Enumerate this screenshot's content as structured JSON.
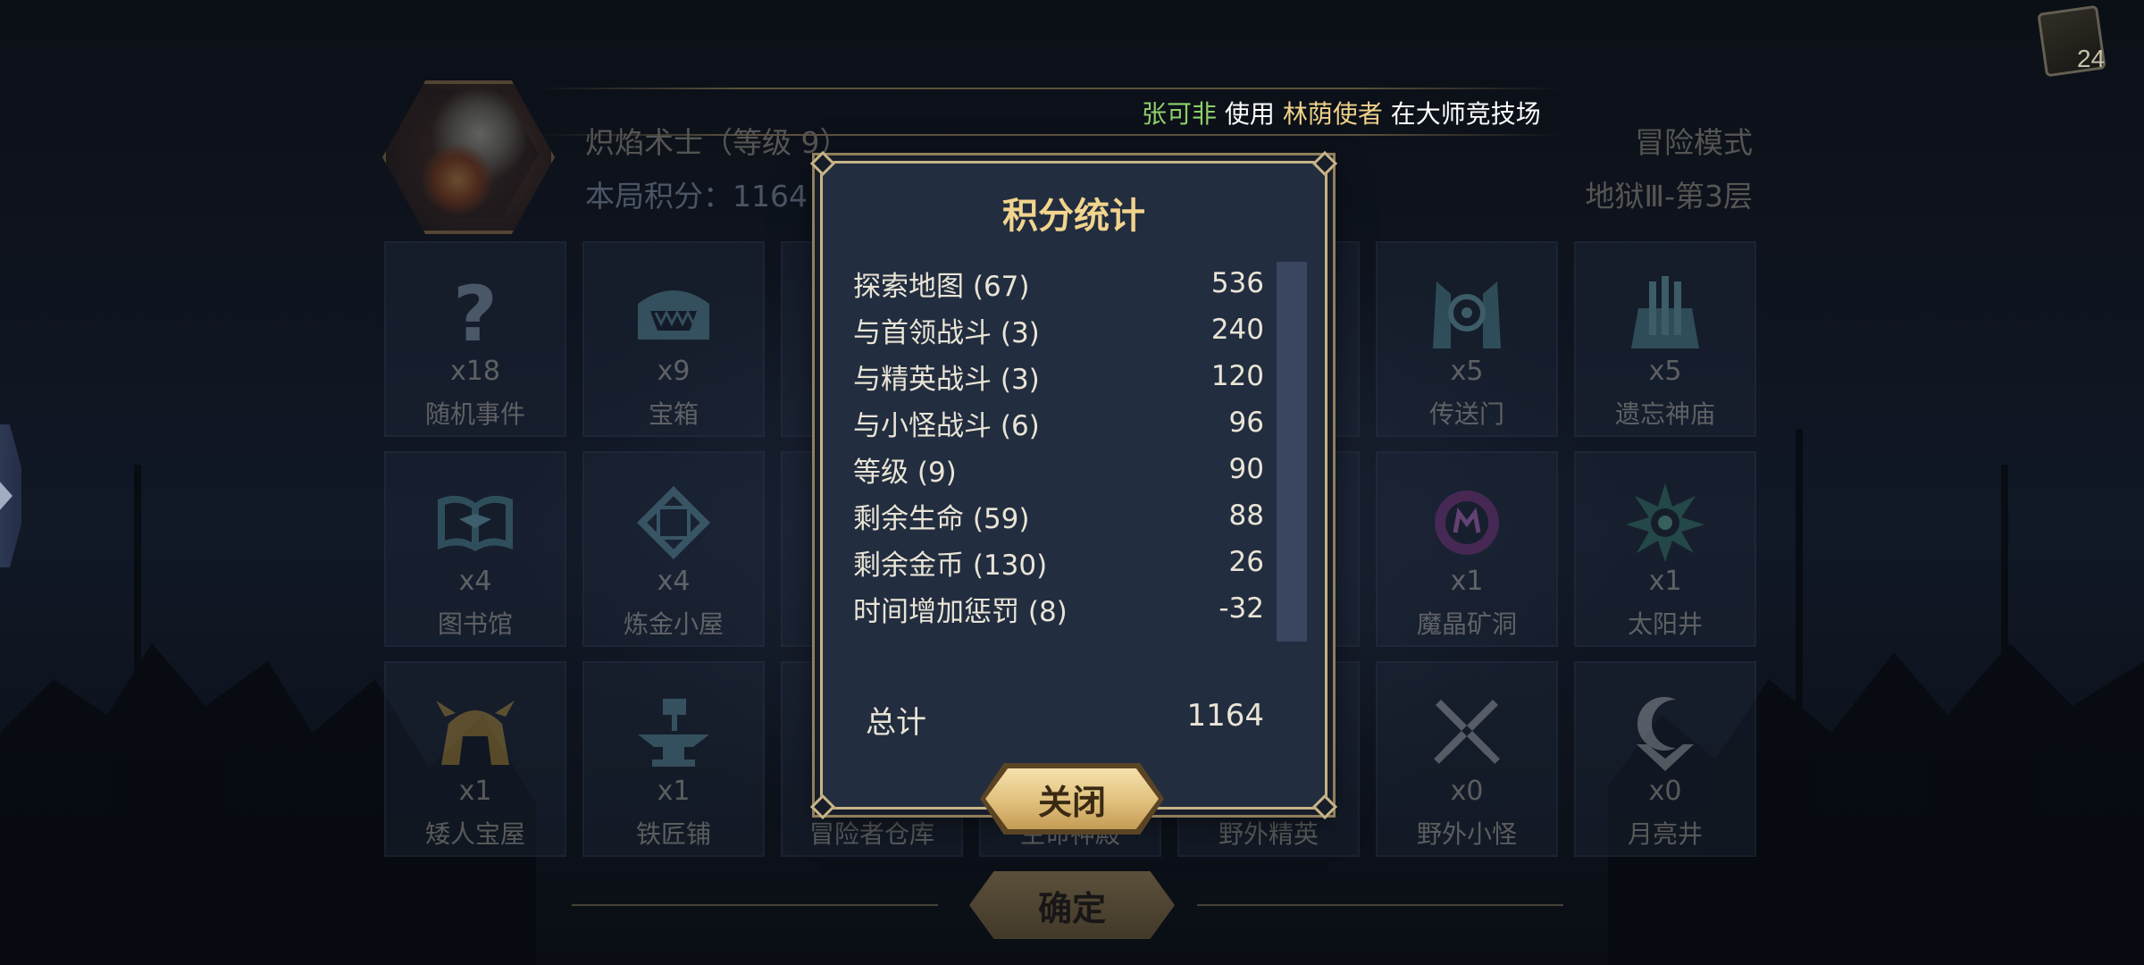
{
  "deck": {
    "count": "24"
  },
  "header": {
    "hero_name": "炽焰术士（等级 9）",
    "score_label": "本局积分：1164",
    "mode": "冒险模式",
    "floor": "地狱Ⅲ-第3层"
  },
  "notice": {
    "player": "张可非",
    "verb": "使用",
    "hero": "林荫使者",
    "place": "在大师竞技场"
  },
  "tiles": [
    {
      "icon": "question-icon",
      "count": "x18",
      "name": "随机事件"
    },
    {
      "icon": "treasure-chest-icon",
      "count": "x9",
      "name": "宝箱"
    },
    {
      "icon": "hidden-icon",
      "count": "",
      "name": ""
    },
    {
      "icon": "hidden-icon",
      "count": "",
      "name": ""
    },
    {
      "icon": "hidden-icon",
      "count": "",
      "name": ""
    },
    {
      "icon": "portal-icon",
      "count": "x5",
      "name": "传送门"
    },
    {
      "icon": "temple-icon",
      "count": "x5",
      "name": "遗忘神庙"
    },
    {
      "icon": "book-icon",
      "count": "x4",
      "name": "图书馆"
    },
    {
      "icon": "alchemy-icon",
      "count": "x4",
      "name": "炼金小屋"
    },
    {
      "icon": "hidden-icon",
      "count": "",
      "name": ""
    },
    {
      "icon": "hidden-icon",
      "count": "",
      "name": ""
    },
    {
      "icon": "hidden-icon",
      "count": "",
      "name": ""
    },
    {
      "icon": "crystal-mine-icon",
      "count": "x1",
      "name": "魔晶矿洞"
    },
    {
      "icon": "sun-well-icon",
      "count": "x1",
      "name": "太阳井"
    },
    {
      "icon": "dwarf-helmet-icon",
      "count": "x1",
      "name": "矮人宝屋"
    },
    {
      "icon": "anvil-icon",
      "count": "x1",
      "name": "铁匠铺"
    },
    {
      "icon": "hidden-icon",
      "count": "",
      "name": "冒险者仓库"
    },
    {
      "icon": "hidden-icon",
      "count": "",
      "name": "生命神殿"
    },
    {
      "icon": "hidden-icon",
      "count": "",
      "name": "野外精英"
    },
    {
      "icon": "crossed-swords-icon",
      "count": "x0",
      "name": "野外小怪"
    },
    {
      "icon": "moon-well-icon",
      "count": "x0",
      "name": "月亮井"
    }
  ],
  "confirm": {
    "label": "确定"
  },
  "modal": {
    "title": "积分统计",
    "rows": [
      {
        "label": "探索地图 (67)",
        "value": "536"
      },
      {
        "label": "与首领战斗 (3)",
        "value": "240"
      },
      {
        "label": "与精英战斗 (3)",
        "value": "120"
      },
      {
        "label": "与小怪战斗 (6)",
        "value": "96"
      },
      {
        "label": "等级 (9)",
        "value": "90"
      },
      {
        "label": "剩余生命 (59)",
        "value": "88"
      },
      {
        "label": "剩余金币 (130)",
        "value": "26"
      },
      {
        "label": "时间增加惩罚 (8)",
        "value": "-32"
      }
    ],
    "total_label": "总计",
    "total_value": "1164",
    "close_label": "关闭"
  }
}
